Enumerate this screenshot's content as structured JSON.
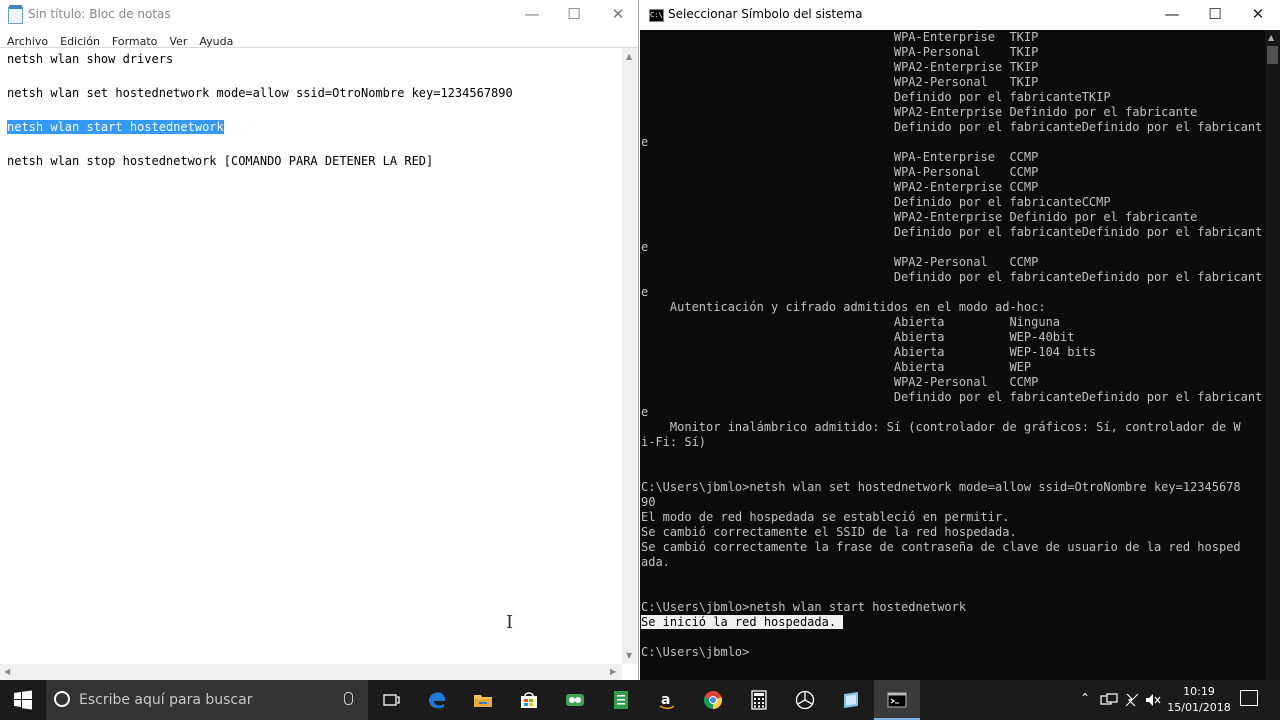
{
  "notepad": {
    "title": "Sin título: Bloc de notas",
    "menu": [
      "Archivo",
      "Edición",
      "Formato",
      "Ver",
      "Ayuda"
    ],
    "lines": [
      "netsh wlan show drivers",
      "netsh wlan set hostednetwork mode=allow ssid=OtroNombre key=1234567890",
      "netsh wlan start hostednetwork",
      "netsh wlan stop hostednetwork [COMANDO PARA DETENER LA RED]"
    ],
    "selected_line_index": 2
  },
  "cmd": {
    "title": "Seleccionar Símbolo del sistema",
    "lines": [
      "                                   WPA-Enterprise  TKIP",
      "                                   WPA-Personal    TKIP",
      "                                   WPA2-Enterprise TKIP",
      "                                   WPA2-Personal   TKIP",
      "                                   Definido por el fabricanteTKIP",
      "                                   WPA2-Enterprise Definido por el fabricante",
      "                                   Definido por el fabricanteDefinido por el fabricant",
      "e",
      "                                   WPA-Enterprise  CCMP",
      "                                   WPA-Personal    CCMP",
      "                                   WPA2-Enterprise CCMP",
      "                                   Definido por el fabricanteCCMP",
      "                                   WPA2-Enterprise Definido por el fabricante",
      "                                   Definido por el fabricanteDefinido por el fabricant",
      "e",
      "                                   WPA2-Personal   CCMP",
      "                                   Definido por el fabricanteDefinido por el fabricant",
      "e",
      "    Autenticación y cifrado admitidos en el modo ad-hoc:",
      "                                   Abierta         Ninguna",
      "                                   Abierta         WEP-40bit",
      "                                   Abierta         WEP-104 bits",
      "                                   Abierta         WEP",
      "                                   WPA2-Personal   CCMP",
      "                                   Definido por el fabricanteDefinido por el fabricant",
      "e",
      "    Monitor inalámbrico admitido: Sí (controlador de gráficos: Sí, controlador de W",
      "i-Fi: Sí)",
      "",
      "",
      "C:\\Users\\jbmlo>netsh wlan set hostednetwork mode=allow ssid=OtroNombre key=12345678",
      "90",
      "El modo de red hospedada se estableció en permitir.",
      "Se cambió correctamente el SSID de la red hospedada.",
      "Se cambió correctamente la frase de contraseña de clave de usuario de la red hosped",
      "ada.",
      "",
      "",
      "C:\\Users\\jbmlo>netsh wlan start hostednetwork",
      "Se inició la red hospedada. ",
      "",
      "C:\\Users\\jbmlo>"
    ],
    "highlight_line_index": 39
  },
  "taskbar": {
    "search_placeholder": "Escribe aquí para buscar",
    "apps": [
      "task-view-icon",
      "edge-icon",
      "file-explorer-icon",
      "store-icon",
      "green-app-icon",
      "green-spreadsheet-icon",
      "amazon-icon",
      "chrome-icon",
      "calculator-icon",
      "media-app-icon",
      "blue-app-icon",
      "cmd-icon"
    ],
    "time": "10:19",
    "date": "15/01/2018"
  },
  "colors": {
    "selection": "#3399ff",
    "taskbar": "#1b1b1b",
    "console_bg": "#0c0c0c",
    "console_fg": "#c0c0c0"
  }
}
